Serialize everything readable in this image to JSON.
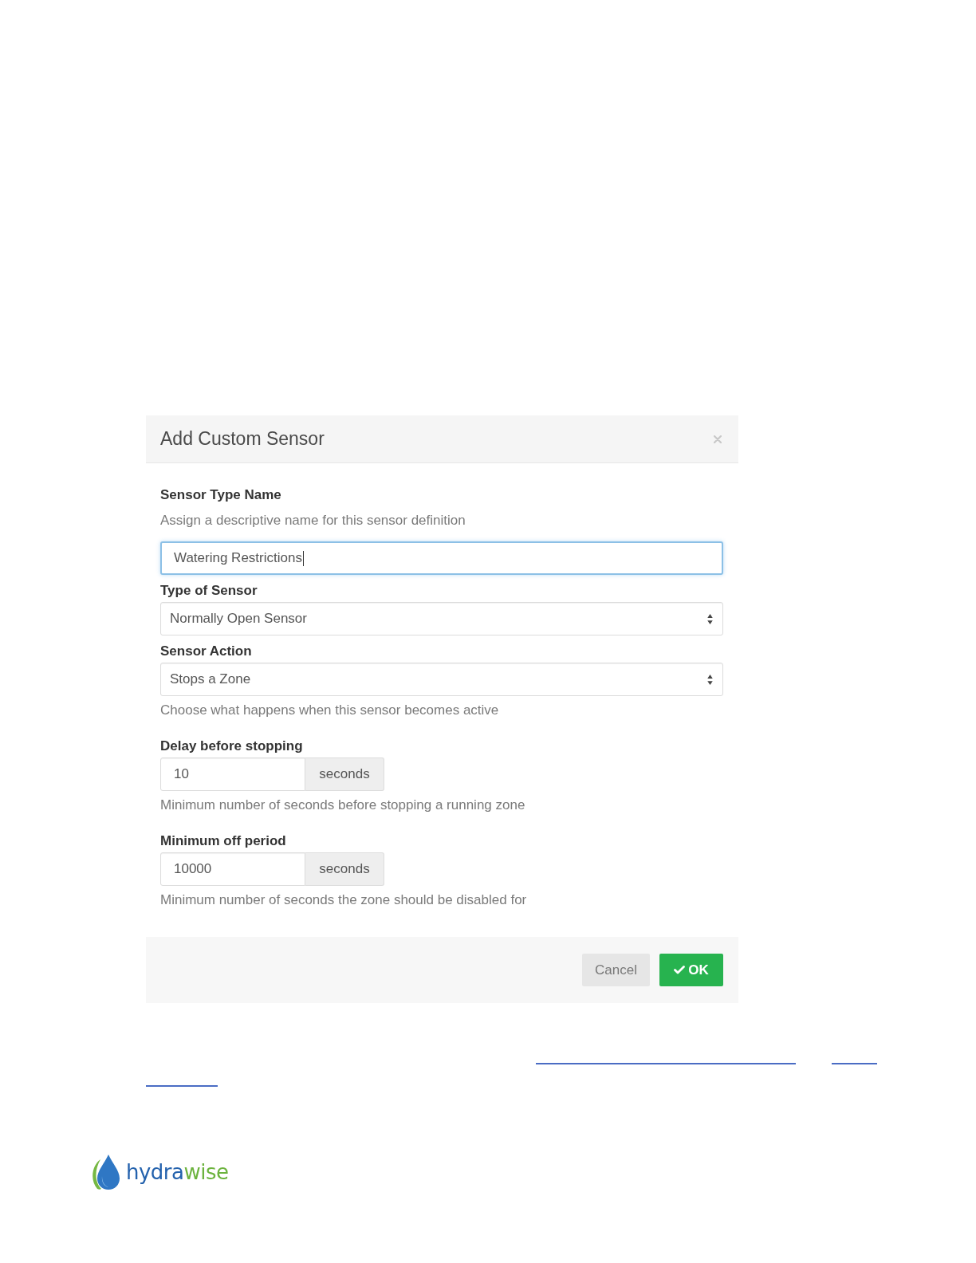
{
  "dialog": {
    "title": "Add Custom Sensor",
    "name_field": {
      "label": "Sensor Type Name",
      "description": "Assign a descriptive name for this sensor definition",
      "value": "Watering Restrictions",
      "focused": true
    },
    "fields": [
      {
        "kind": "select",
        "label": "Type of Sensor",
        "value": "Normally Open Sensor",
        "focused": false
      },
      {
        "kind": "select",
        "label": "Sensor Action",
        "value": "Stops a Zone",
        "help": "Choose what happens when this sensor becomes active",
        "focused": false
      },
      {
        "kind": "number",
        "label": "Delay before stopping",
        "value": "10",
        "unit": "seconds",
        "help": "Minimum number of seconds before stopping a running zone",
        "focused": false
      },
      {
        "kind": "number",
        "label": "Minimum off period",
        "value": "10000",
        "unit": "seconds",
        "help": "Minimum number of seconds the zone should be disabled for",
        "focused": false
      }
    ],
    "buttons": [
      {
        "kind": "default",
        "label": "Cancel"
      },
      {
        "kind": "primary",
        "label": "OK"
      }
    ]
  },
  "logo": {
    "wordmark": [
      {
        "text": "hydra",
        "color": "#2462ad"
      },
      {
        "text": "wise",
        "color": "#6cb33e"
      }
    ]
  }
}
